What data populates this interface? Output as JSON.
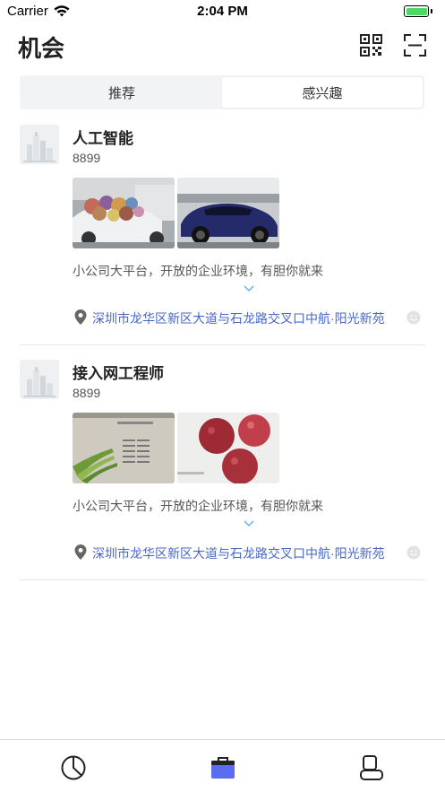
{
  "status_bar": {
    "carrier": "Carrier",
    "time": "2:04 PM",
    "battery_level": 1.0,
    "wifi_icon": "wifi-icon",
    "battery_icon": "battery-icon"
  },
  "header": {
    "title": "机会",
    "qr_icon": "qr-code-icon",
    "scan_icon": "scan-icon"
  },
  "tabs": [
    {
      "label": "推荐",
      "active": false
    },
    {
      "label": "感兴趣",
      "active": true
    }
  ],
  "posts": [
    {
      "title": "人工智能",
      "number": "8899",
      "description": "小公司大平台，开放的企业环境，有胆你就来",
      "address": "深圳市龙华区新区大道与石龙路交叉口中航·阳光新苑",
      "photos": [
        "car-with-toys-photo",
        "blue-car-photo"
      ]
    },
    {
      "title": "接入网工程师",
      "number": "8899",
      "description": "小公司大平台，开放的企业环境，有胆你就来",
      "address": "深圳市龙华区新区大道与石龙路交叉口中航·阳光新苑",
      "photos": [
        "document-with-scallions-photo",
        "lychee-photo"
      ]
    }
  ],
  "tab_bar": {
    "items": [
      "pie-chart-icon",
      "briefcase-icon",
      "profile-icon"
    ],
    "active_index": 1
  },
  "colors": {
    "accent": "#5b6cf0",
    "link": "#4a67c7",
    "expand": "#5aa9e6"
  }
}
